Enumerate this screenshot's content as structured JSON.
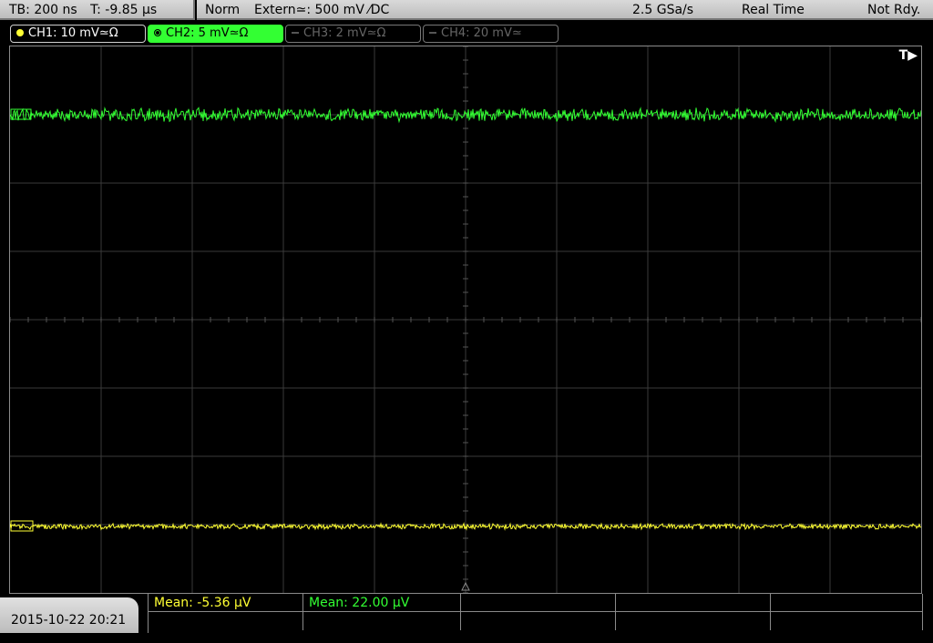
{
  "status": {
    "timebase": "TB: 200 ns",
    "trigger_time": "T: -9.85 µs",
    "mode": "Norm",
    "trigger_source": "Extern≃: 500 mV ⁄DC",
    "sample_rate": "2.5 GSa/s",
    "acq_mode": "Real Time",
    "ready": "Not Rdy."
  },
  "channels": [
    {
      "label": "CH1: 10 mV≃Ω",
      "color": "#ffff33",
      "state": "on"
    },
    {
      "label": "CH2: 5 mV≃Ω",
      "color": "#33ff33",
      "state": "selected"
    },
    {
      "label": "CH3: 2 mV≃Ω",
      "color": "#666666",
      "state": "off"
    },
    {
      "label": "CH4: 20 mV≃",
      "color": "#666666",
      "state": "off"
    }
  ],
  "trigger_marker": "T▶",
  "measurements": [
    {
      "label": "Mean: -5.36 µV",
      "color": "#ffff33"
    },
    {
      "label": "Mean: 22.00 µV",
      "color": "#33ff33"
    }
  ],
  "datetime": "2015-10-22 20:21",
  "icons": {
    "ch1_marker": "channel-1-ground-marker-icon",
    "ch2_marker": "channel-2-ground-marker-icon",
    "trigger_position": "trigger-position-triangle-icon"
  }
}
